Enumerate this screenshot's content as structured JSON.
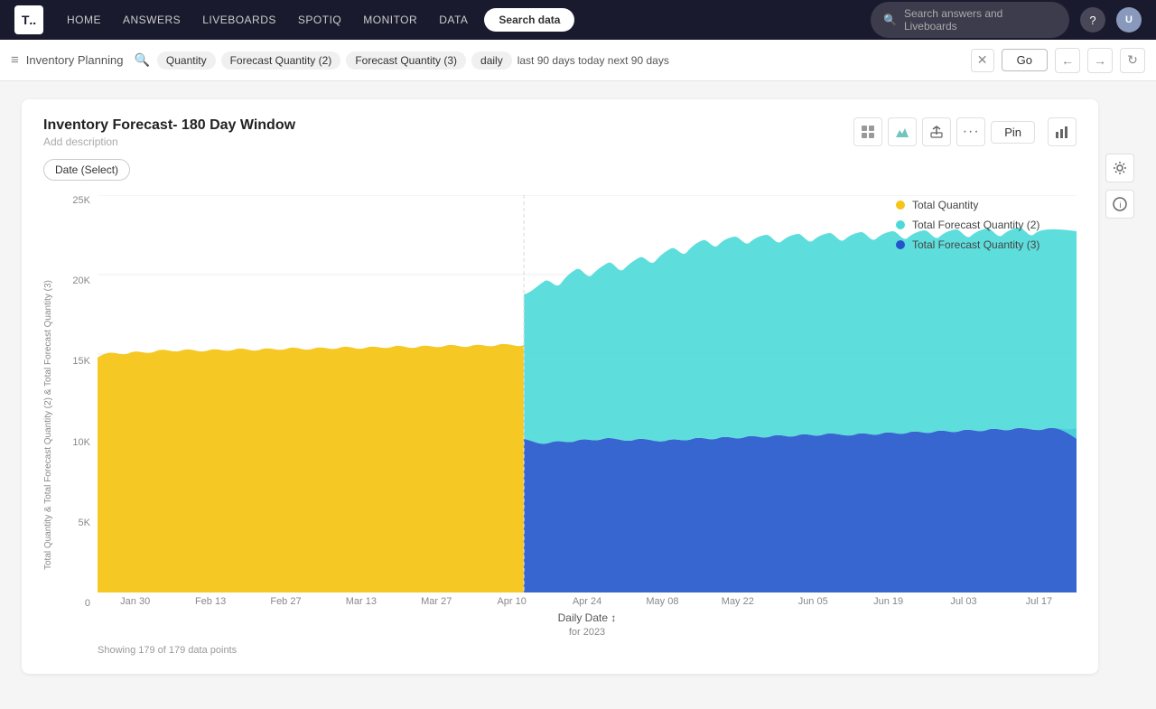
{
  "topnav": {
    "logo_text": "T",
    "nav_items": [
      "HOME",
      "ANSWERS",
      "LIVEBOARDS",
      "SPOTIQ",
      "MONITOR",
      "DATA"
    ],
    "search_data_label": "Search data",
    "search_placeholder": "Search answers and Liveboards",
    "help_label": "?",
    "avatar_initials": "U"
  },
  "breadcrumb": {
    "title": "Inventory Planning",
    "tags": [
      "Quantity",
      "Forecast Quantity (2)",
      "Forecast Quantity (3)",
      "daily"
    ],
    "range_text": "last 90 days today next 90 days",
    "go_label": "Go"
  },
  "chart": {
    "title": "Inventory Forecast- 180 Day Window",
    "description": "Add description",
    "filter_label": "Date (Select)",
    "toolbar": {
      "table_icon": "⊞",
      "chart_icon": "📊",
      "share_icon": "↑",
      "more_icon": "•••",
      "pin_label": "Pin"
    },
    "legend": [
      {
        "label": "Total Quantity",
        "color": "#f5c518"
      },
      {
        "label": "Total Forecast Quantity (2)",
        "color": "#4dd9d9"
      },
      {
        "label": "Total Forecast Quantity (3)",
        "color": "#2255cc"
      }
    ],
    "y_axis": {
      "label": "Total Quantity & Total Forecast Quantity (2) & Total Forecast Quantity (3)",
      "ticks": [
        "25K",
        "20K",
        "15K",
        "10K",
        "5K",
        "0"
      ]
    },
    "x_axis": {
      "ticks": [
        "Jan 30",
        "Feb 13",
        "Feb 27",
        "Mar 13",
        "Mar 27",
        "Apr 10",
        "Apr 24",
        "May 08",
        "May 22",
        "Jun 05",
        "Jun 19",
        "Jul 03",
        "Jul 17"
      ],
      "label": "Daily Date",
      "sublabel": "for 2023"
    },
    "footer": "Showing 179 of 179 data points",
    "segments": {
      "yellow_end_x": 0.435,
      "forecast_start_x": 0.435
    }
  }
}
